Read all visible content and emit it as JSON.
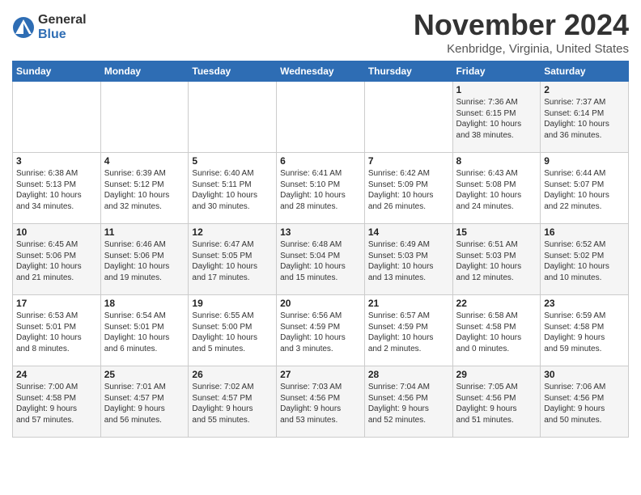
{
  "header": {
    "logo_general": "General",
    "logo_blue": "Blue",
    "title": "November 2024",
    "location": "Kenbridge, Virginia, United States"
  },
  "days_of_week": [
    "Sunday",
    "Monday",
    "Tuesday",
    "Wednesday",
    "Thursday",
    "Friday",
    "Saturday"
  ],
  "weeks": [
    [
      {
        "day": "",
        "info": ""
      },
      {
        "day": "",
        "info": ""
      },
      {
        "day": "",
        "info": ""
      },
      {
        "day": "",
        "info": ""
      },
      {
        "day": "",
        "info": ""
      },
      {
        "day": "1",
        "info": "Sunrise: 7:36 AM\nSunset: 6:15 PM\nDaylight: 10 hours\nand 38 minutes."
      },
      {
        "day": "2",
        "info": "Sunrise: 7:37 AM\nSunset: 6:14 PM\nDaylight: 10 hours\nand 36 minutes."
      }
    ],
    [
      {
        "day": "3",
        "info": "Sunrise: 6:38 AM\nSunset: 5:13 PM\nDaylight: 10 hours\nand 34 minutes."
      },
      {
        "day": "4",
        "info": "Sunrise: 6:39 AM\nSunset: 5:12 PM\nDaylight: 10 hours\nand 32 minutes."
      },
      {
        "day": "5",
        "info": "Sunrise: 6:40 AM\nSunset: 5:11 PM\nDaylight: 10 hours\nand 30 minutes."
      },
      {
        "day": "6",
        "info": "Sunrise: 6:41 AM\nSunset: 5:10 PM\nDaylight: 10 hours\nand 28 minutes."
      },
      {
        "day": "7",
        "info": "Sunrise: 6:42 AM\nSunset: 5:09 PM\nDaylight: 10 hours\nand 26 minutes."
      },
      {
        "day": "8",
        "info": "Sunrise: 6:43 AM\nSunset: 5:08 PM\nDaylight: 10 hours\nand 24 minutes."
      },
      {
        "day": "9",
        "info": "Sunrise: 6:44 AM\nSunset: 5:07 PM\nDaylight: 10 hours\nand 22 minutes."
      }
    ],
    [
      {
        "day": "10",
        "info": "Sunrise: 6:45 AM\nSunset: 5:06 PM\nDaylight: 10 hours\nand 21 minutes."
      },
      {
        "day": "11",
        "info": "Sunrise: 6:46 AM\nSunset: 5:06 PM\nDaylight: 10 hours\nand 19 minutes."
      },
      {
        "day": "12",
        "info": "Sunrise: 6:47 AM\nSunset: 5:05 PM\nDaylight: 10 hours\nand 17 minutes."
      },
      {
        "day": "13",
        "info": "Sunrise: 6:48 AM\nSunset: 5:04 PM\nDaylight: 10 hours\nand 15 minutes."
      },
      {
        "day": "14",
        "info": "Sunrise: 6:49 AM\nSunset: 5:03 PM\nDaylight: 10 hours\nand 13 minutes."
      },
      {
        "day": "15",
        "info": "Sunrise: 6:51 AM\nSunset: 5:03 PM\nDaylight: 10 hours\nand 12 minutes."
      },
      {
        "day": "16",
        "info": "Sunrise: 6:52 AM\nSunset: 5:02 PM\nDaylight: 10 hours\nand 10 minutes."
      }
    ],
    [
      {
        "day": "17",
        "info": "Sunrise: 6:53 AM\nSunset: 5:01 PM\nDaylight: 10 hours\nand 8 minutes."
      },
      {
        "day": "18",
        "info": "Sunrise: 6:54 AM\nSunset: 5:01 PM\nDaylight: 10 hours\nand 6 minutes."
      },
      {
        "day": "19",
        "info": "Sunrise: 6:55 AM\nSunset: 5:00 PM\nDaylight: 10 hours\nand 5 minutes."
      },
      {
        "day": "20",
        "info": "Sunrise: 6:56 AM\nSunset: 4:59 PM\nDaylight: 10 hours\nand 3 minutes."
      },
      {
        "day": "21",
        "info": "Sunrise: 6:57 AM\nSunset: 4:59 PM\nDaylight: 10 hours\nand 2 minutes."
      },
      {
        "day": "22",
        "info": "Sunrise: 6:58 AM\nSunset: 4:58 PM\nDaylight: 10 hours\nand 0 minutes."
      },
      {
        "day": "23",
        "info": "Sunrise: 6:59 AM\nSunset: 4:58 PM\nDaylight: 9 hours\nand 59 minutes."
      }
    ],
    [
      {
        "day": "24",
        "info": "Sunrise: 7:00 AM\nSunset: 4:58 PM\nDaylight: 9 hours\nand 57 minutes."
      },
      {
        "day": "25",
        "info": "Sunrise: 7:01 AM\nSunset: 4:57 PM\nDaylight: 9 hours\nand 56 minutes."
      },
      {
        "day": "26",
        "info": "Sunrise: 7:02 AM\nSunset: 4:57 PM\nDaylight: 9 hours\nand 55 minutes."
      },
      {
        "day": "27",
        "info": "Sunrise: 7:03 AM\nSunset: 4:56 PM\nDaylight: 9 hours\nand 53 minutes."
      },
      {
        "day": "28",
        "info": "Sunrise: 7:04 AM\nSunset: 4:56 PM\nDaylight: 9 hours\nand 52 minutes."
      },
      {
        "day": "29",
        "info": "Sunrise: 7:05 AM\nSunset: 4:56 PM\nDaylight: 9 hours\nand 51 minutes."
      },
      {
        "day": "30",
        "info": "Sunrise: 7:06 AM\nSunset: 4:56 PM\nDaylight: 9 hours\nand 50 minutes."
      }
    ]
  ]
}
